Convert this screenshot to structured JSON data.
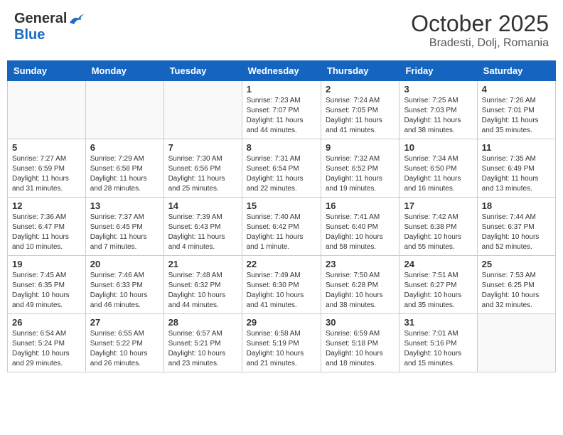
{
  "header": {
    "logo_general": "General",
    "logo_blue": "Blue",
    "month_title": "October 2025",
    "location": "Bradesti, Dolj, Romania"
  },
  "days_of_week": [
    "Sunday",
    "Monday",
    "Tuesday",
    "Wednesday",
    "Thursday",
    "Friday",
    "Saturday"
  ],
  "weeks": [
    [
      {
        "day": "",
        "info": ""
      },
      {
        "day": "",
        "info": ""
      },
      {
        "day": "",
        "info": ""
      },
      {
        "day": "1",
        "info": "Sunrise: 7:23 AM\nSunset: 7:07 PM\nDaylight: 11 hours\nand 44 minutes."
      },
      {
        "day": "2",
        "info": "Sunrise: 7:24 AM\nSunset: 7:05 PM\nDaylight: 11 hours\nand 41 minutes."
      },
      {
        "day": "3",
        "info": "Sunrise: 7:25 AM\nSunset: 7:03 PM\nDaylight: 11 hours\nand 38 minutes."
      },
      {
        "day": "4",
        "info": "Sunrise: 7:26 AM\nSunset: 7:01 PM\nDaylight: 11 hours\nand 35 minutes."
      }
    ],
    [
      {
        "day": "5",
        "info": "Sunrise: 7:27 AM\nSunset: 6:59 PM\nDaylight: 11 hours\nand 31 minutes."
      },
      {
        "day": "6",
        "info": "Sunrise: 7:29 AM\nSunset: 6:58 PM\nDaylight: 11 hours\nand 28 minutes."
      },
      {
        "day": "7",
        "info": "Sunrise: 7:30 AM\nSunset: 6:56 PM\nDaylight: 11 hours\nand 25 minutes."
      },
      {
        "day": "8",
        "info": "Sunrise: 7:31 AM\nSunset: 6:54 PM\nDaylight: 11 hours\nand 22 minutes."
      },
      {
        "day": "9",
        "info": "Sunrise: 7:32 AM\nSunset: 6:52 PM\nDaylight: 11 hours\nand 19 minutes."
      },
      {
        "day": "10",
        "info": "Sunrise: 7:34 AM\nSunset: 6:50 PM\nDaylight: 11 hours\nand 16 minutes."
      },
      {
        "day": "11",
        "info": "Sunrise: 7:35 AM\nSunset: 6:49 PM\nDaylight: 11 hours\nand 13 minutes."
      }
    ],
    [
      {
        "day": "12",
        "info": "Sunrise: 7:36 AM\nSunset: 6:47 PM\nDaylight: 11 hours\nand 10 minutes."
      },
      {
        "day": "13",
        "info": "Sunrise: 7:37 AM\nSunset: 6:45 PM\nDaylight: 11 hours\nand 7 minutes."
      },
      {
        "day": "14",
        "info": "Sunrise: 7:39 AM\nSunset: 6:43 PM\nDaylight: 11 hours\nand 4 minutes."
      },
      {
        "day": "15",
        "info": "Sunrise: 7:40 AM\nSunset: 6:42 PM\nDaylight: 11 hours\nand 1 minute."
      },
      {
        "day": "16",
        "info": "Sunrise: 7:41 AM\nSunset: 6:40 PM\nDaylight: 10 hours\nand 58 minutes."
      },
      {
        "day": "17",
        "info": "Sunrise: 7:42 AM\nSunset: 6:38 PM\nDaylight: 10 hours\nand 55 minutes."
      },
      {
        "day": "18",
        "info": "Sunrise: 7:44 AM\nSunset: 6:37 PM\nDaylight: 10 hours\nand 52 minutes."
      }
    ],
    [
      {
        "day": "19",
        "info": "Sunrise: 7:45 AM\nSunset: 6:35 PM\nDaylight: 10 hours\nand 49 minutes."
      },
      {
        "day": "20",
        "info": "Sunrise: 7:46 AM\nSunset: 6:33 PM\nDaylight: 10 hours\nand 46 minutes."
      },
      {
        "day": "21",
        "info": "Sunrise: 7:48 AM\nSunset: 6:32 PM\nDaylight: 10 hours\nand 44 minutes."
      },
      {
        "day": "22",
        "info": "Sunrise: 7:49 AM\nSunset: 6:30 PM\nDaylight: 10 hours\nand 41 minutes."
      },
      {
        "day": "23",
        "info": "Sunrise: 7:50 AM\nSunset: 6:28 PM\nDaylight: 10 hours\nand 38 minutes."
      },
      {
        "day": "24",
        "info": "Sunrise: 7:51 AM\nSunset: 6:27 PM\nDaylight: 10 hours\nand 35 minutes."
      },
      {
        "day": "25",
        "info": "Sunrise: 7:53 AM\nSunset: 6:25 PM\nDaylight: 10 hours\nand 32 minutes."
      }
    ],
    [
      {
        "day": "26",
        "info": "Sunrise: 6:54 AM\nSunset: 5:24 PM\nDaylight: 10 hours\nand 29 minutes."
      },
      {
        "day": "27",
        "info": "Sunrise: 6:55 AM\nSunset: 5:22 PM\nDaylight: 10 hours\nand 26 minutes."
      },
      {
        "day": "28",
        "info": "Sunrise: 6:57 AM\nSunset: 5:21 PM\nDaylight: 10 hours\nand 23 minutes."
      },
      {
        "day": "29",
        "info": "Sunrise: 6:58 AM\nSunset: 5:19 PM\nDaylight: 10 hours\nand 21 minutes."
      },
      {
        "day": "30",
        "info": "Sunrise: 6:59 AM\nSunset: 5:18 PM\nDaylight: 10 hours\nand 18 minutes."
      },
      {
        "day": "31",
        "info": "Sunrise: 7:01 AM\nSunset: 5:16 PM\nDaylight: 10 hours\nand 15 minutes."
      },
      {
        "day": "",
        "info": ""
      }
    ]
  ]
}
